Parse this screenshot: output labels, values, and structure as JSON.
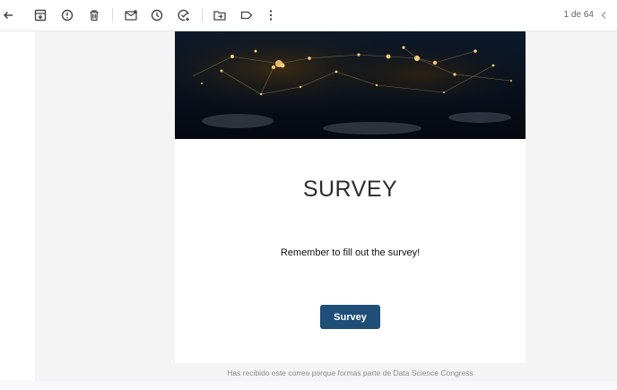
{
  "toolbar": {
    "icons": [
      "back-arrow-icon",
      "archive-icon",
      "report-spam-icon",
      "delete-icon",
      "mark-unread-icon",
      "snooze-icon",
      "add-task-icon",
      "move-to-icon",
      "label-icon",
      "more-vert-icon"
    ],
    "pager": "1 de 64"
  },
  "email": {
    "title": "SURVEY",
    "body": "Remember to fill out the survey!",
    "button_label": "Survey",
    "footer": "Has recibido este correo porque formas parte de Data Science Congress"
  },
  "colors": {
    "button_bg": "#1f4e79",
    "toolbar_icon": "#444746",
    "page_bg": "#f6f8fc"
  }
}
